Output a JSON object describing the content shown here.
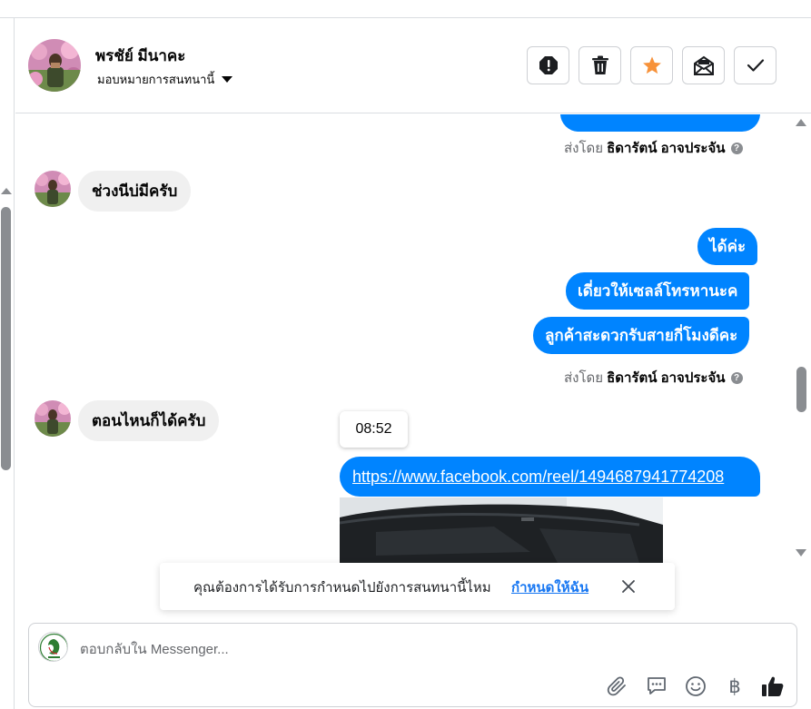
{
  "header": {
    "contact_name": "พรชัย์ มีนาคะ",
    "assign_label": "มอบหมายการสนทนานี้",
    "actions": {
      "spam": "mark-spam",
      "delete": "delete-conversation",
      "star": "star-conversation",
      "unread": "mark-unread",
      "done": "mark-done"
    },
    "colors": {
      "star": "#f7923a",
      "icon": "#1c1e21"
    }
  },
  "chat": {
    "messages": [
      {
        "from": "page",
        "text": ""
      },
      {
        "from": "page",
        "meta_prefix": "ส่งโดย",
        "meta_name": "ธิดารัตน์ อาจประจัน"
      },
      {
        "from": "customer",
        "text": "ช่วงนีบ่มีครับ"
      },
      {
        "from": "page",
        "text": "ได้ค่ะ"
      },
      {
        "from": "page",
        "text": "เดี่ยวให้เซลล์โทรหานะค"
      },
      {
        "from": "page",
        "text": "ลูกค้าสะดวกรับสายกี่โมงดีคะ"
      },
      {
        "from": "page",
        "meta_prefix": "ส่งโดย",
        "meta_name": "ธิดารัตน์ อาจประจัน"
      },
      {
        "from": "customer",
        "text": "ตอนไหนก็ได้ครับ"
      },
      {
        "from": "page",
        "time_tooltip": "08:52"
      },
      {
        "from": "page",
        "link": "https://www.facebook.com/reel/1494687941774208"
      }
    ],
    "colors": {
      "outgoing": "#0084ff",
      "incoming": "#f0f0f0"
    }
  },
  "notice": {
    "text": "คุณต้องการได้รับการกำหนดไปยังการสนทนานี้ไหม",
    "link": "กำหนดให้ฉัน"
  },
  "composer": {
    "placeholder": "ตอบกลับใน Messenger...",
    "tools": [
      "paperclip-icon",
      "saved-reply-icon",
      "emoji-icon",
      "baht-icon",
      "thumbs-up-icon"
    ],
    "baht_symbol": "฿"
  }
}
